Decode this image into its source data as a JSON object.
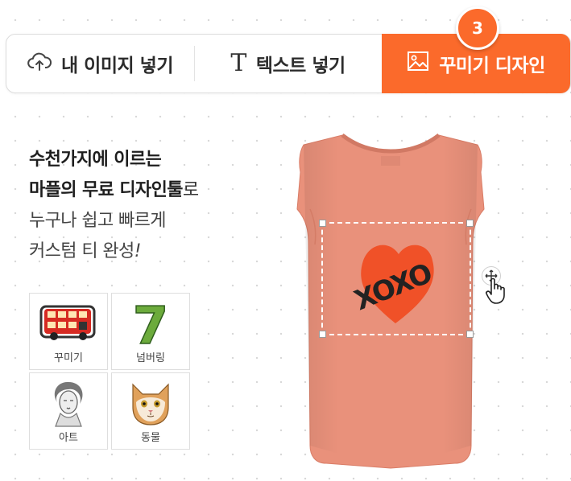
{
  "tabs": [
    {
      "label": "내 이미지 넣기",
      "icon": "cloud-upload-icon"
    },
    {
      "label": "텍스트 넣기",
      "icon": "text-t-icon",
      "icon_glyph": "T"
    },
    {
      "label": "꾸미기 디자인",
      "icon": "image-icon",
      "active": true
    }
  ],
  "step_badge": "3",
  "promo": {
    "line1": "수천가지에 이르는",
    "line2_bold": "마플의 무료 디자인툴",
    "line2_rest": "로",
    "line3": "누구나 쉽고 빠르게",
    "line4": "커스텀 티 완성",
    "line4_mark": "!"
  },
  "categories": [
    {
      "label": "꾸미기",
      "icon": "red-bus-sticker-icon"
    },
    {
      "label": "넘버링",
      "icon": "number-seven-icon",
      "glyph": "7"
    },
    {
      "label": "아트",
      "icon": "portrait-sketch-icon"
    },
    {
      "label": "동물",
      "icon": "cat-face-icon"
    }
  ],
  "product": {
    "name": "sleeveless-tshirt",
    "color": "#e9917b",
    "design_text": "XOXO",
    "design_heart_color": "#f05128"
  },
  "colors": {
    "accent": "#fb6a2b"
  }
}
